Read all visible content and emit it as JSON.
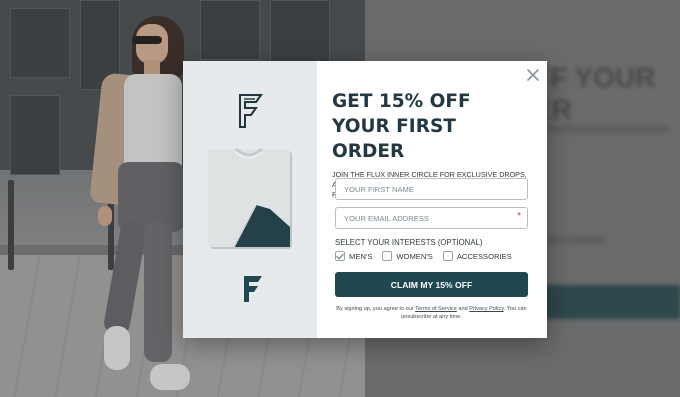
{
  "modal": {
    "headline": "GET 15% OFF YOUR FIRST ORDER",
    "subtext": "JOIN THE FLUX INNER CIRCLE FOR EXCLUSIVE DROPS, ACCESS TO PRESALES AND 15% OFF YOUR NEXT PURCHASE.",
    "first_name_placeholder": "YOUR FIRST NAME",
    "email_placeholder": "YOUR EMAIL ADDRESS",
    "required_mark": "*",
    "interests_label": "SELECT YOUR INTERESTS (OPTIONAL)",
    "interests": [
      {
        "label": "MEN'S",
        "checked": true
      },
      {
        "label": "WOMEN'S",
        "checked": false
      },
      {
        "label": "ACCESSORIES",
        "checked": false
      }
    ],
    "cta_label": "CLAIM MY 15% OFF",
    "legal": {
      "prefix": "By signing up, you agree to our",
      "terms_link": "Terms of Service",
      "and": "and",
      "privacy_link": "Privacy Policy",
      "suffix": ". You can unsubscribe at any time."
    }
  },
  "background_page": {
    "ghost_heading": "FF YOUR\nER"
  },
  "icons": {
    "close": "close-icon",
    "logo": "flux-logo-icon",
    "product": "folded-tshirt-image"
  },
  "colors": {
    "primary": "#1f4851",
    "heading": "#243844",
    "required": "#d33a3a"
  }
}
